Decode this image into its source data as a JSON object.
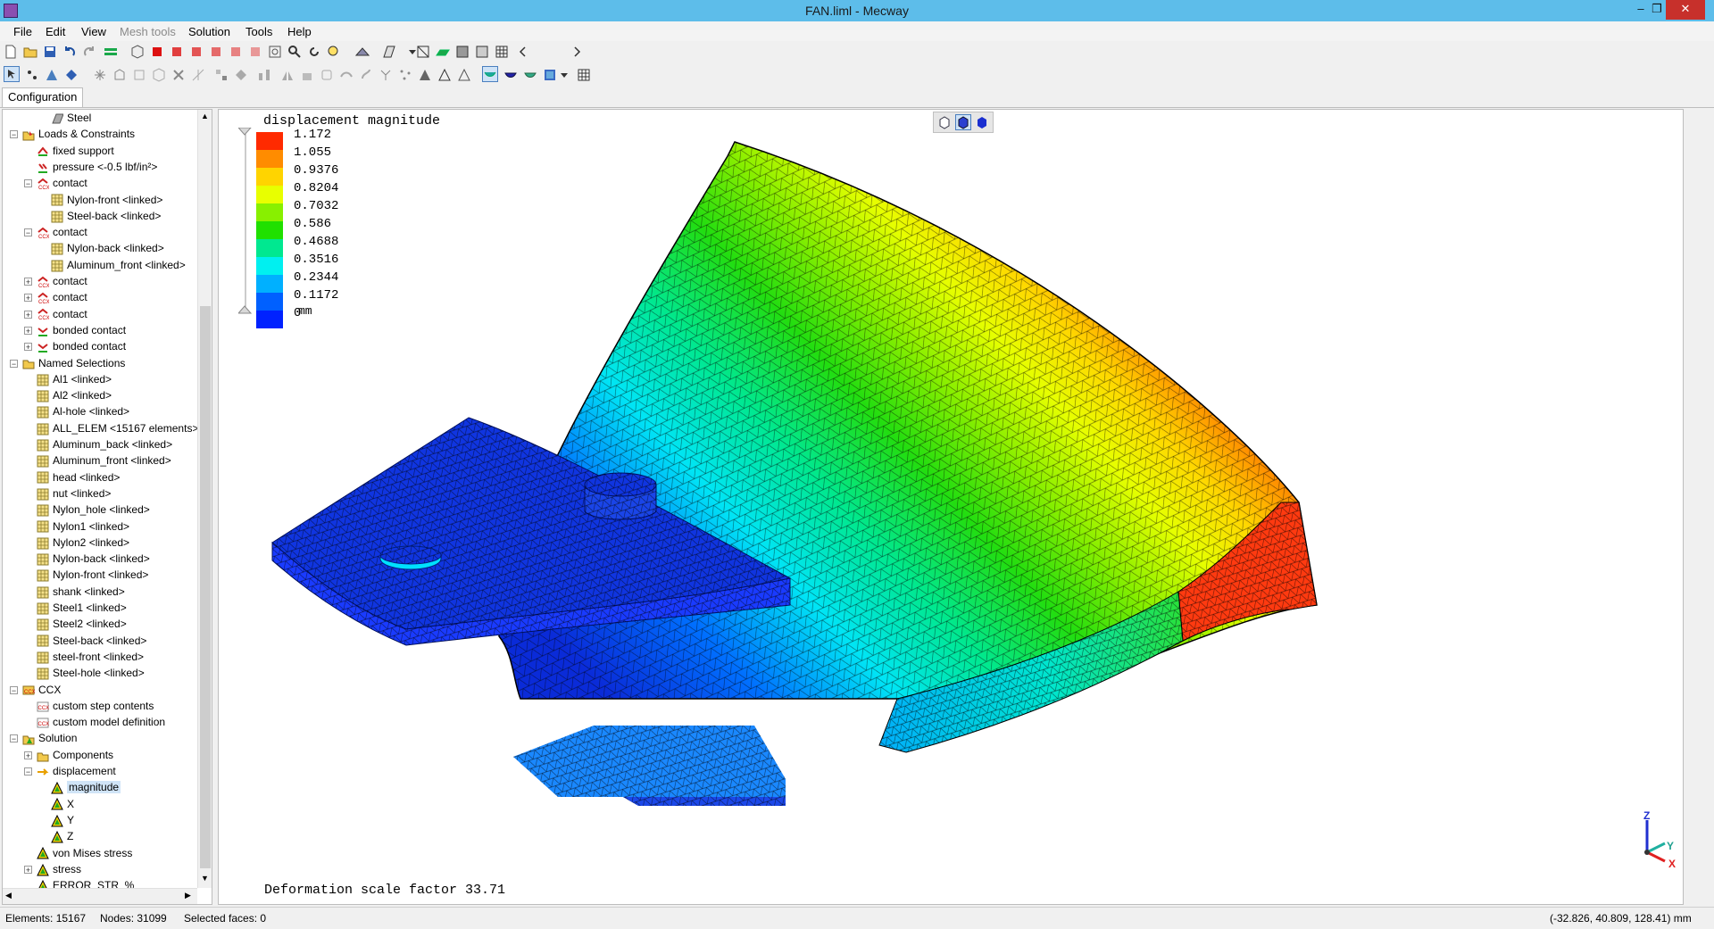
{
  "window": {
    "title": "FAN.liml - Mecway",
    "minimize": "–",
    "restore": "❐",
    "close": "✕"
  },
  "menu": [
    {
      "label": "File",
      "enabled": true
    },
    {
      "label": "Edit",
      "enabled": true
    },
    {
      "label": "View",
      "enabled": true
    },
    {
      "label": "Mesh tools",
      "enabled": false
    },
    {
      "label": "Solution",
      "enabled": true
    },
    {
      "label": "Tools",
      "enabled": true
    },
    {
      "label": "Help",
      "enabled": true
    }
  ],
  "tabs": {
    "configuration": "Configuration"
  },
  "tree": [
    {
      "label": "Steel",
      "level": 3,
      "icon": "material-icon",
      "expander": null
    },
    {
      "label": "Loads & Constraints",
      "level": 1,
      "icon": "loads-folder-icon",
      "expander": "-"
    },
    {
      "label": "fixed support",
      "level": 2,
      "icon": "support-icon",
      "expander": null
    },
    {
      "label": "pressure <-0.5 lbf/in²>",
      "level": 2,
      "icon": "pressure-icon",
      "expander": null
    },
    {
      "label": "contact",
      "level": 2,
      "icon": "ccx-contact-icon",
      "expander": "-"
    },
    {
      "label": "Nylon-front <linked>",
      "level": 3,
      "icon": "selection-icon",
      "expander": null
    },
    {
      "label": "Steel-back <linked>",
      "level": 3,
      "icon": "selection-icon",
      "expander": null
    },
    {
      "label": "contact",
      "level": 2,
      "icon": "ccx-contact-icon",
      "expander": "-"
    },
    {
      "label": "Nylon-back <linked>",
      "level": 3,
      "icon": "selection-icon",
      "expander": null
    },
    {
      "label": "Aluminum_front <linked>",
      "level": 3,
      "icon": "selection-icon",
      "expander": null
    },
    {
      "label": "contact",
      "level": 2,
      "icon": "ccx-contact-icon",
      "expander": "+"
    },
    {
      "label": "contact",
      "level": 2,
      "icon": "ccx-contact-icon",
      "expander": "+"
    },
    {
      "label": "contact",
      "level": 2,
      "icon": "ccx-contact-icon",
      "expander": "+"
    },
    {
      "label": "bonded contact",
      "level": 2,
      "icon": "bonded-contact-icon",
      "expander": "+"
    },
    {
      "label": "bonded contact",
      "level": 2,
      "icon": "bonded-contact-icon",
      "expander": "+"
    },
    {
      "label": "Named Selections",
      "level": 1,
      "icon": "named-selections-folder-icon",
      "expander": "-"
    },
    {
      "label": "Al1 <linked>",
      "level": 2,
      "icon": "selection-icon",
      "expander": null
    },
    {
      "label": "Al2 <linked>",
      "level": 2,
      "icon": "selection-icon",
      "expander": null
    },
    {
      "label": "Al-hole <linked>",
      "level": 2,
      "icon": "selection-icon",
      "expander": null
    },
    {
      "label": "ALL_ELEM <15167 elements>",
      "level": 2,
      "icon": "selection-icon",
      "expander": null
    },
    {
      "label": "Aluminum_back <linked>",
      "level": 2,
      "icon": "selection-icon",
      "expander": null
    },
    {
      "label": "Aluminum_front <linked>",
      "level": 2,
      "icon": "selection-icon",
      "expander": null
    },
    {
      "label": "head <linked>",
      "level": 2,
      "icon": "selection-icon",
      "expander": null
    },
    {
      "label": "nut <linked>",
      "level": 2,
      "icon": "selection-icon",
      "expander": null
    },
    {
      "label": "Nylon_hole <linked>",
      "level": 2,
      "icon": "selection-icon",
      "expander": null
    },
    {
      "label": "Nylon1 <linked>",
      "level": 2,
      "icon": "selection-icon",
      "expander": null
    },
    {
      "label": "Nylon2 <linked>",
      "level": 2,
      "icon": "selection-icon",
      "expander": null
    },
    {
      "label": "Nylon-back <linked>",
      "level": 2,
      "icon": "selection-icon",
      "expander": null
    },
    {
      "label": "Nylon-front <linked>",
      "level": 2,
      "icon": "selection-icon",
      "expander": null
    },
    {
      "label": "shank <linked>",
      "level": 2,
      "icon": "selection-icon",
      "expander": null
    },
    {
      "label": "Steel1 <linked>",
      "level": 2,
      "icon": "selection-icon",
      "expander": null
    },
    {
      "label": "Steel2 <linked>",
      "level": 2,
      "icon": "selection-icon",
      "expander": null
    },
    {
      "label": "Steel-back <linked>",
      "level": 2,
      "icon": "selection-icon",
      "expander": null
    },
    {
      "label": "steel-front <linked>",
      "level": 2,
      "icon": "selection-icon",
      "expander": null
    },
    {
      "label": "Steel-hole <linked>",
      "level": 2,
      "icon": "selection-icon",
      "expander": null
    },
    {
      "label": "CCX",
      "level": 1,
      "icon": "ccx-folder-icon",
      "expander": "-"
    },
    {
      "label": "custom step contents",
      "level": 2,
      "icon": "ccx-icon",
      "expander": null
    },
    {
      "label": "custom model definition",
      "level": 2,
      "icon": "ccx-icon",
      "expander": null
    },
    {
      "label": "Solution",
      "level": 1,
      "icon": "solution-icon",
      "expander": "-"
    },
    {
      "label": "Components",
      "level": 2,
      "icon": "components-icon",
      "expander": "+"
    },
    {
      "label": "displacement",
      "level": 2,
      "icon": "displacement-icon",
      "expander": "-"
    },
    {
      "label": "magnitude",
      "level": 3,
      "icon": "result-icon",
      "expander": null,
      "selected": true
    },
    {
      "label": "X",
      "level": 3,
      "icon": "result-icon",
      "expander": null
    },
    {
      "label": "Y",
      "level": 3,
      "icon": "result-icon",
      "expander": null
    },
    {
      "label": "Z",
      "level": 3,
      "icon": "result-icon",
      "expander": null
    },
    {
      "label": "von Mises stress",
      "level": 2,
      "icon": "result-icon",
      "expander": null
    },
    {
      "label": "stress",
      "level": 2,
      "icon": "result-icon",
      "expander": "+"
    },
    {
      "label": "ERROR_STR_%_",
      "level": 2,
      "icon": "result-icon",
      "expander": null
    }
  ],
  "viewport": {
    "result_title": "displacement magnitude",
    "legend": {
      "values": [
        "1.172",
        "1.055",
        "0.9376",
        "0.8204",
        "0.7032",
        "0.586",
        "0.4688",
        "0.3516",
        "0.2344",
        "0.1172",
        "0"
      ],
      "colors": [
        "#ff2a00",
        "#ff8c00",
        "#ffd400",
        "#e8ff00",
        "#88f000",
        "#20e000",
        "#00e890",
        "#00f0f0",
        "#00b0ff",
        "#0060ff",
        "#0022ff"
      ],
      "unit": "mm"
    },
    "deformation_text": "Deformation scale factor 33.71",
    "triad": {
      "x": "X",
      "y": "Y",
      "z": "Z"
    }
  },
  "status": {
    "elements": "Elements: 15167",
    "nodes": "Nodes: 31099",
    "selected": "Selected faces: 0",
    "coords": "(-32.826, 40.809, 128.41) mm"
  }
}
